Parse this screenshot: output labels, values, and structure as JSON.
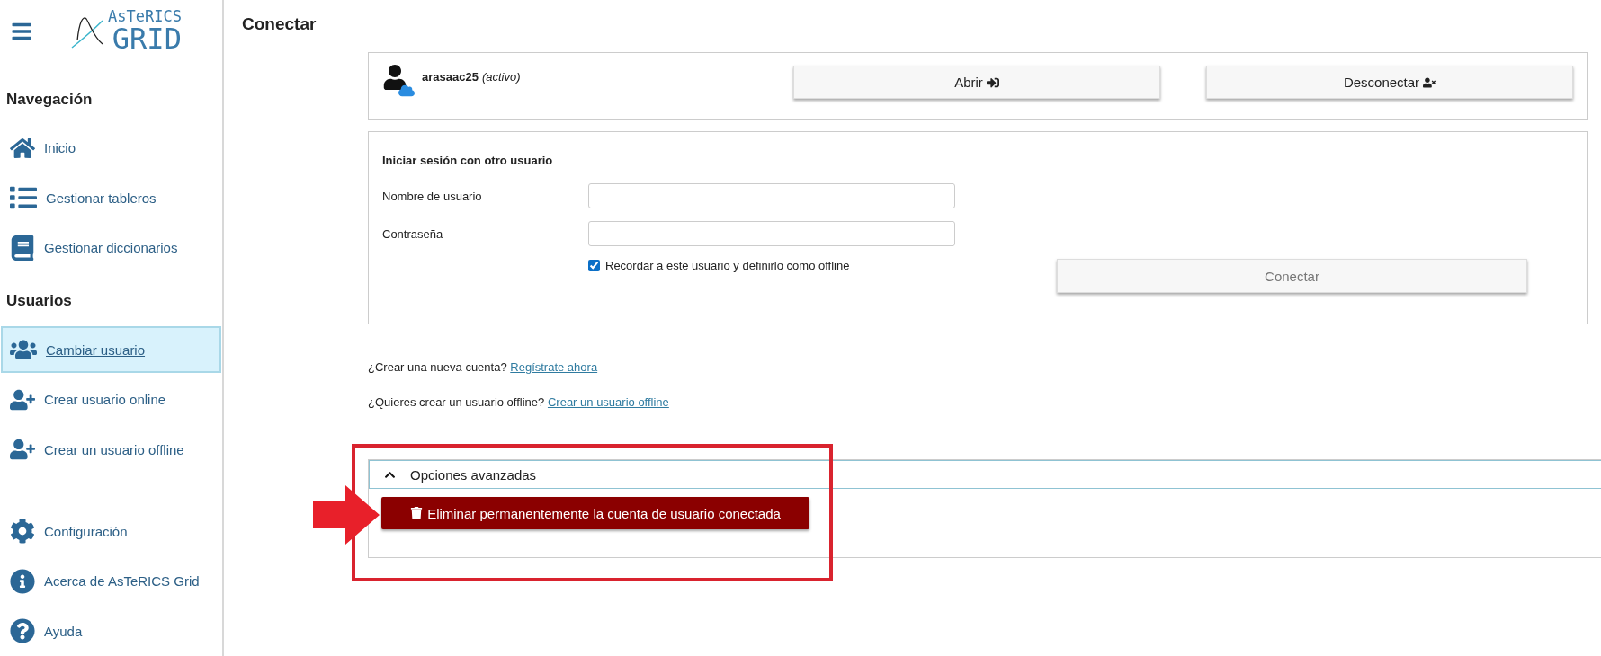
{
  "app": {
    "logo_top": "AsTeRICS",
    "logo_bottom": "GRID"
  },
  "sidebar": {
    "sections": [
      {
        "heading": "Navegación",
        "items": [
          {
            "label": "Inicio",
            "selected": false
          },
          {
            "label": "Gestionar tableros",
            "selected": false
          },
          {
            "label": "Gestionar diccionarios",
            "selected": false
          }
        ]
      },
      {
        "heading": "Usuarios",
        "items": [
          {
            "label": "Cambiar usuario",
            "selected": true
          },
          {
            "label": "Crear usuario online",
            "selected": false
          },
          {
            "label": "Crear un usuario offline",
            "selected": false
          }
        ]
      }
    ],
    "bottom_items": [
      {
        "label": "Configuración",
        "selected": false
      },
      {
        "label": "Acerca de AsTeRICS Grid",
        "selected": false
      },
      {
        "label": "Ayuda",
        "selected": false
      }
    ]
  },
  "page": {
    "title": "Conectar"
  },
  "active_user": {
    "name": "arasaac25",
    "status": "(activo)",
    "buttons": [
      "Abrir",
      "Desconectar"
    ]
  },
  "login": {
    "heading": "Iniciar sesión con otro usuario",
    "fields": [
      {
        "label": "Nombre de usuario"
      },
      {
        "label": "Contraseña"
      }
    ],
    "remember": {
      "label": "Recordar a este usuario y definirlo como offline",
      "checked": true
    },
    "submit": "Conectar"
  },
  "links": [
    {
      "text": "¿Crear una nueva cuenta?",
      "link": "Regístrate ahora"
    },
    {
      "text": "¿Quieres crear un usuario offline?",
      "link": "Crear un usuario offline"
    }
  ],
  "advanced": {
    "title": "Opciones avanzadas",
    "expanded": true,
    "delete_button": "Eliminar permanentemente la cuenta de usuario conectada"
  }
}
